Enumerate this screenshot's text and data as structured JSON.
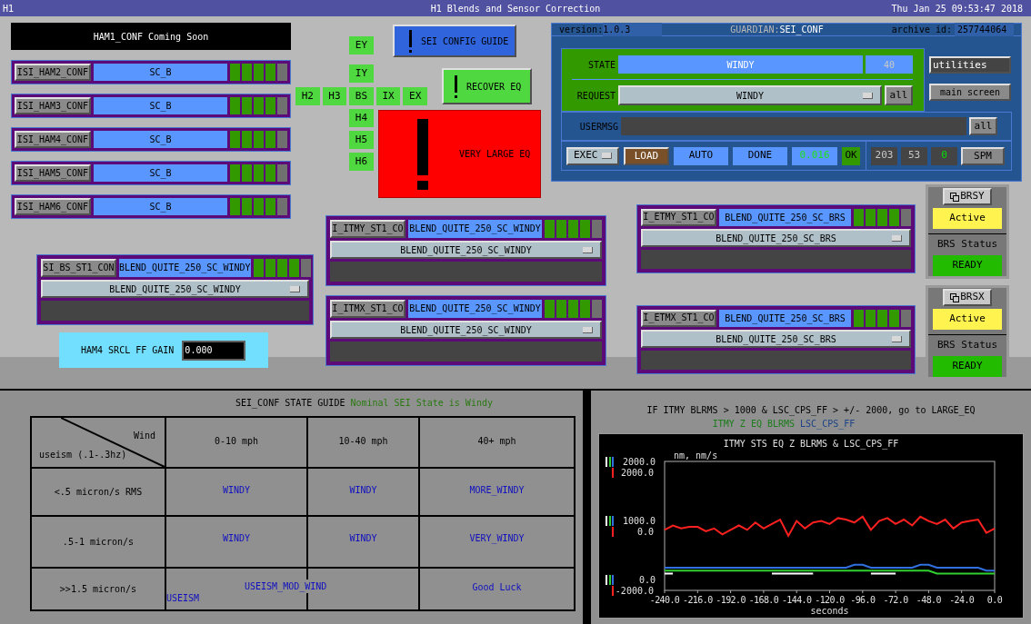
{
  "title_bar": {
    "left": "H1",
    "title": "H1 Blends and Sensor Correction",
    "datetime": "Thu Jan 25 09:53:47 2018"
  },
  "ham1_banner": "HAM1_CONF Coming Soon",
  "ham_configs": [
    {
      "button": "ISI_HAM2_CONF",
      "state": "SC_B",
      "lamps": [
        {
          "on": true
        },
        {
          "on": true
        },
        {
          "on": true
        },
        {
          "on": true
        },
        {
          "on": false
        }
      ]
    },
    {
      "button": "ISI_HAM3_CONF",
      "state": "SC_B",
      "lamps": [
        {
          "on": true
        },
        {
          "on": true
        },
        {
          "on": true
        },
        {
          "on": true
        },
        {
          "on": false
        }
      ]
    },
    {
      "button": "ISI_HAM4_CONF",
      "state": "SC_B",
      "lamps": [
        {
          "on": true
        },
        {
          "on": true
        },
        {
          "on": true
        },
        {
          "on": true
        },
        {
          "on": false
        }
      ]
    },
    {
      "button": "ISI_HAM5_CONF",
      "state": "SC_B",
      "lamps": [
        {
          "on": true
        },
        {
          "on": true
        },
        {
          "on": true
        },
        {
          "on": true
        },
        {
          "on": false
        }
      ]
    },
    {
      "button": "ISI_HAM6_CONF",
      "state": "SC_B",
      "lamps": [
        {
          "on": true
        },
        {
          "on": true
        },
        {
          "on": true
        },
        {
          "on": true
        },
        {
          "on": false
        }
      ]
    }
  ],
  "station_rows": [
    [
      "EY"
    ],
    [
      "IY"
    ],
    [
      "H2",
      "H3",
      "BS",
      "IX",
      "EX"
    ],
    [
      "H4"
    ],
    [
      "H5"
    ],
    [
      "H6"
    ]
  ],
  "sei_config_guide": "SEI CONFIG GUIDE",
  "recover_eq": "RECOVER EQ",
  "very_large_eq": "VERY LARGE EQ",
  "guardian": {
    "version_label": "version:",
    "version": "1.0.3",
    "guardian_label": "GUARDIAN:",
    "guardian": "SEI_CONF",
    "archive_label": "archive id:",
    "archive_id": "257744064",
    "state_label": "STATE",
    "state": "WINDY",
    "state_index": "40",
    "request_label": "REQUEST",
    "request": "WINDY",
    "request_all": "all",
    "utilities": "utilities",
    "main_screen": "main screen",
    "usermsg_label": "USERMSG",
    "usermsg_all": "all",
    "exec": "EXEC",
    "load": "LOAD",
    "mode": "AUTO",
    "status": "DONE",
    "timing": "0.016",
    "ok": "OK",
    "counters": [
      {
        "value": "203",
        "active": false
      },
      {
        "value": "53",
        "active": false
      },
      {
        "value": "0",
        "active": true
      }
    ],
    "spm": "SPM"
  },
  "blend_panels": {
    "left": [
      {
        "button": "SI_BS_ST1_CON",
        "current": "BLEND_QUITE_250_SC_WINDY",
        "request": "BLEND_QUITE_250_SC_WINDY",
        "lamps": [
          {
            "on": true
          },
          {
            "on": true
          },
          {
            "on": true
          },
          {
            "on": true
          },
          {
            "on": false
          }
        ]
      }
    ],
    "middle": [
      {
        "button": "I_ITMY_ST1_CO",
        "current": "BLEND_QUITE_250_SC_WINDY",
        "request": "BLEND_QUITE_250_SC_WINDY",
        "lamps": [
          {
            "on": true
          },
          {
            "on": true
          },
          {
            "on": true
          },
          {
            "on": true
          },
          {
            "on": false
          }
        ]
      },
      {
        "button": "I_ITMX_ST1_CO",
        "current": "BLEND_QUITE_250_SC_WINDY",
        "request": "BLEND_QUITE_250_SC_WINDY",
        "lamps": [
          {
            "on": true
          },
          {
            "on": true
          },
          {
            "on": true
          },
          {
            "on": true
          },
          {
            "on": false
          }
        ]
      }
    ],
    "right": [
      {
        "button": "I_ETMY_ST1_CO",
        "current": "BLEND_QUITE_250_SC_BRS",
        "request": "BLEND_QUITE_250_SC_BRS",
        "lamps": [
          {
            "on": true
          },
          {
            "on": true
          },
          {
            "on": true
          },
          {
            "on": true
          },
          {
            "on": false
          }
        ]
      },
      {
        "button": "I_ETMX_ST1_CO",
        "current": "BLEND_QUITE_250_SC_BRS",
        "request": "BLEND_QUITE_250_SC_BRS",
        "lamps": [
          {
            "on": true
          },
          {
            "on": true
          },
          {
            "on": true
          },
          {
            "on": true
          },
          {
            "on": false
          }
        ]
      }
    ]
  },
  "ham4_srcl_gain": {
    "label": "HAM4 SRCL FF GAIN",
    "value": "0.000"
  },
  "brs": [
    {
      "button": "BRSY",
      "state": "Active",
      "status_label": "BRS Status",
      "status": "READY"
    },
    {
      "button": "BRSX",
      "state": "Active",
      "status_label": "BRS Status",
      "status": "READY"
    }
  ],
  "state_guide": {
    "title": "SEI_CONF STATE GUIDE",
    "note": "Nominal SEI State is Windy",
    "corner_top": "Wind",
    "corner_bottom": "useism (.1-.3hz)",
    "columns": [
      "0-10 mph",
      "10-40 mph",
      "40+ mph"
    ],
    "rows": [
      {
        "label": "<.5 micron/s RMS",
        "cells": [
          "WINDY",
          "WINDY",
          "MORE_WINDY"
        ]
      },
      {
        "label": ".5-1 micron/s",
        "cells": [
          "WINDY",
          "WINDY",
          "VERY_WINDY"
        ]
      }
    ],
    "last_row": {
      "label": ">>1.5 micron/s",
      "spanning_text": "USEISM_MOD_WIND",
      "corner_text": "USEISM",
      "cell": "Good Luck"
    }
  },
  "trend": {
    "condition": "IF ITMY BLRMS > 1000 & LSC_CPS_FF > +/- 2000, go to LARGE_EQ",
    "chart_data": {
      "type": "line",
      "title": "ITMY STS EQ Z BLRMS & LSC_CPS_FF",
      "xlabel": "seconds",
      "ylabel": "nm, nm/s",
      "x": [
        -240,
        -234,
        -228,
        -222,
        -216,
        -210,
        -204,
        -198,
        -192,
        -186,
        -180,
        -174,
        -168,
        -162,
        -156,
        -150,
        -144,
        -138,
        -132,
        -126,
        -120,
        -114,
        -108,
        -102,
        -96,
        -90,
        -84,
        -78,
        -72,
        -66,
        -60,
        -54,
        -48,
        -42,
        -36,
        -30,
        -24,
        -18,
        -12,
        -6,
        0
      ],
      "xlim": [
        -240,
        0
      ],
      "xticks": [
        {
          "value": -240,
          "label": "-240.0"
        },
        {
          "value": -216,
          "label": "-216.0"
        },
        {
          "value": -192,
          "label": "-192.0"
        },
        {
          "value": -168,
          "label": "-168.0"
        },
        {
          "value": -144,
          "label": "-144.0"
        },
        {
          "value": -120,
          "label": "-120.0"
        },
        {
          "value": -96,
          "label": "-96.0"
        },
        {
          "value": -72,
          "label": "-72.0"
        },
        {
          "value": -48,
          "label": "-48.0"
        },
        {
          "value": -24,
          "label": "-24.0"
        },
        {
          "value": 0,
          "label": "0.0"
        }
      ],
      "ylim": [
        -185,
        2000
      ],
      "yticks": [
        {
          "value": 2000,
          "label": "2000.0"
        },
        {
          "value": 1000,
          "label": "1000.0"
        },
        {
          "value": 0,
          "label": "0.0"
        }
      ],
      "y2lim": [
        -2000,
        2370
      ],
      "y2ticks": [
        {
          "value": 2000,
          "label": "2000.0"
        },
        {
          "value": 0,
          "label": "0.0"
        },
        {
          "value": -2000,
          "label": "-2000.0"
        }
      ],
      "series": [
        {
          "color": "#ffffff",
          "axis": "y",
          "values": [
            100,
            100,
            null,
            null,
            null,
            null,
            null,
            null,
            null,
            null,
            null,
            null,
            null,
            100,
            100,
            100,
            100,
            100,
            100,
            null,
            null,
            null,
            null,
            null,
            null,
            100,
            100,
            100,
            100,
            null,
            null,
            null,
            null,
            null,
            null,
            null,
            null,
            null,
            null,
            null,
            null
          ]
        },
        {
          "name": "ITMY Z EQ BLRMS",
          "color": "#30d030",
          "axis": "y",
          "values": [
            150,
            150,
            150,
            150,
            150,
            150,
            150,
            150,
            150,
            150,
            150,
            150,
            150,
            150,
            150,
            150,
            150,
            150,
            150,
            150,
            150,
            150,
            150,
            150,
            150,
            150,
            150,
            150,
            150,
            150,
            150,
            150,
            150,
            100,
            100,
            100,
            100,
            100,
            100,
            100,
            100
          ]
        },
        {
          "name": "LSC_CPS_FF",
          "color": "#3070e0",
          "axis": "y",
          "values": [
            200,
            200,
            200,
            200,
            200,
            200,
            200,
            200,
            200,
            200,
            200,
            200,
            200,
            200,
            200,
            200,
            200,
            200,
            200,
            200,
            200,
            200,
            200,
            250,
            250,
            200,
            200,
            200,
            200,
            200,
            200,
            250,
            250,
            200,
            200,
            200,
            200,
            200,
            200,
            150,
            150
          ]
        },
        {
          "color": "#ff2020",
          "axis": "y2",
          "values": [
            50,
            200,
            100,
            150,
            150,
            0,
            100,
            -100,
            50,
            200,
            50,
            300,
            100,
            250,
            400,
            -150,
            350,
            100,
            300,
            350,
            250,
            450,
            400,
            300,
            500,
            50,
            350,
            450,
            250,
            400,
            200,
            500,
            350,
            250,
            400,
            100,
            300,
            350,
            400,
            -50,
            100
          ]
        }
      ]
    }
  }
}
